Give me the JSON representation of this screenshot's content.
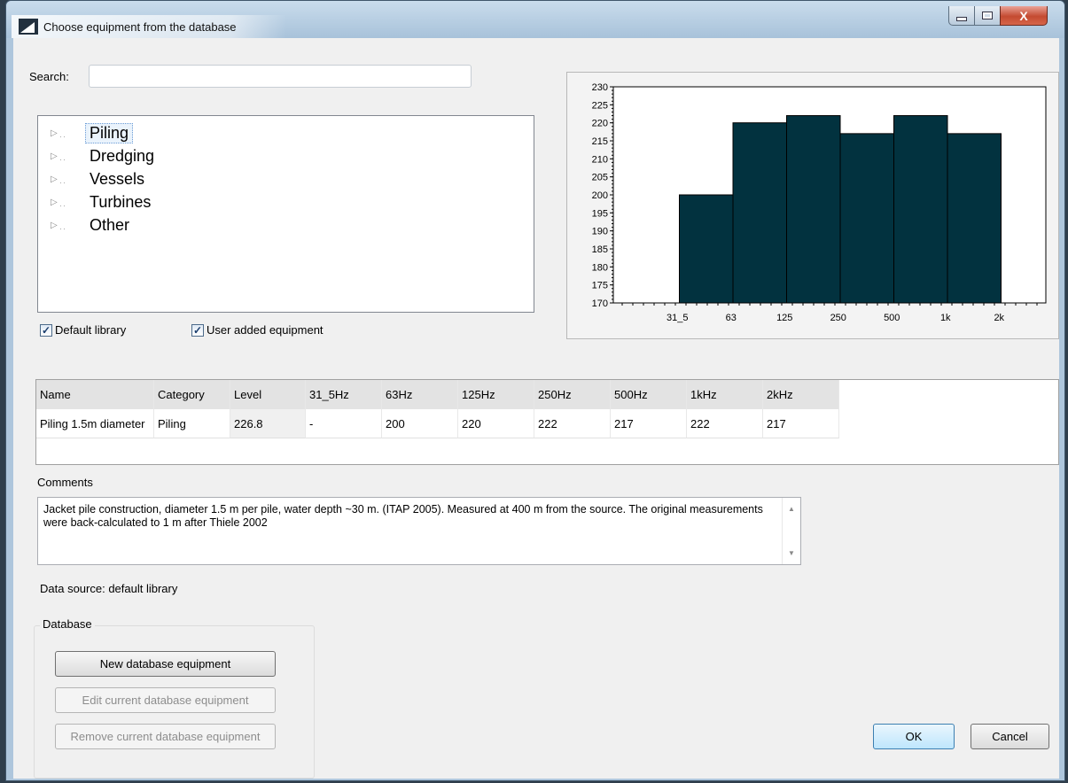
{
  "window": {
    "title": "Choose equipment from the database",
    "close_glyph": "X"
  },
  "search": {
    "label": "Search:",
    "value": "",
    "placeholder": ""
  },
  "tree": {
    "items": [
      {
        "label": "Piling",
        "selected": true
      },
      {
        "label": "Dredging",
        "selected": false
      },
      {
        "label": "Vessels",
        "selected": false
      },
      {
        "label": "Turbines",
        "selected": false
      },
      {
        "label": "Other",
        "selected": false
      }
    ],
    "expander_icon": "triangle-right-icon"
  },
  "filters": {
    "default_library": {
      "label": "Default library",
      "checked": true
    },
    "user_added": {
      "label": "User added equipment",
      "checked": true
    },
    "check_glyph": "✓"
  },
  "chart_data": {
    "type": "bar",
    "categories": [
      "31_5",
      "63",
      "125",
      "250",
      "500",
      "1k",
      "2k"
    ],
    "values": [
      null,
      200,
      220,
      222,
      217,
      222,
      217
    ],
    "ylim": [
      170,
      230
    ],
    "yticks": [
      170,
      175,
      180,
      185,
      190,
      195,
      200,
      205,
      210,
      215,
      220,
      225,
      230
    ],
    "bar_color": "#02323f",
    "title": "",
    "xlabel": "",
    "ylabel": "",
    "grid": false
  },
  "table": {
    "columns": [
      "Name",
      "Category",
      "Level",
      "31_5Hz",
      "63Hz",
      "125Hz",
      "250Hz",
      "500Hz",
      "1kHz",
      "2kHz"
    ],
    "rows": [
      [
        "Piling 1.5m diameter",
        "Piling",
        "226.8",
        "-",
        "200",
        "220",
        "222",
        "217",
        "222",
        "217"
      ]
    ]
  },
  "comments": {
    "label": "Comments",
    "text": "Jacket pile construction, diameter 1.5 m per pile, water depth ~30 m. (ITAP 2005). Measured at 400 m from the source. The original measurements were back-calculated to 1 m after Thiele 2002"
  },
  "data_source": "Data source: default library",
  "database": {
    "group_label": "Database",
    "new_button": "New database equipment",
    "edit_button": "Edit current database equipment",
    "remove_button": "Remove current database equipment"
  },
  "dialog": {
    "ok": "OK",
    "cancel": "Cancel"
  },
  "colors": {
    "accent": "#3c7fb1",
    "bar": "#02323f"
  }
}
